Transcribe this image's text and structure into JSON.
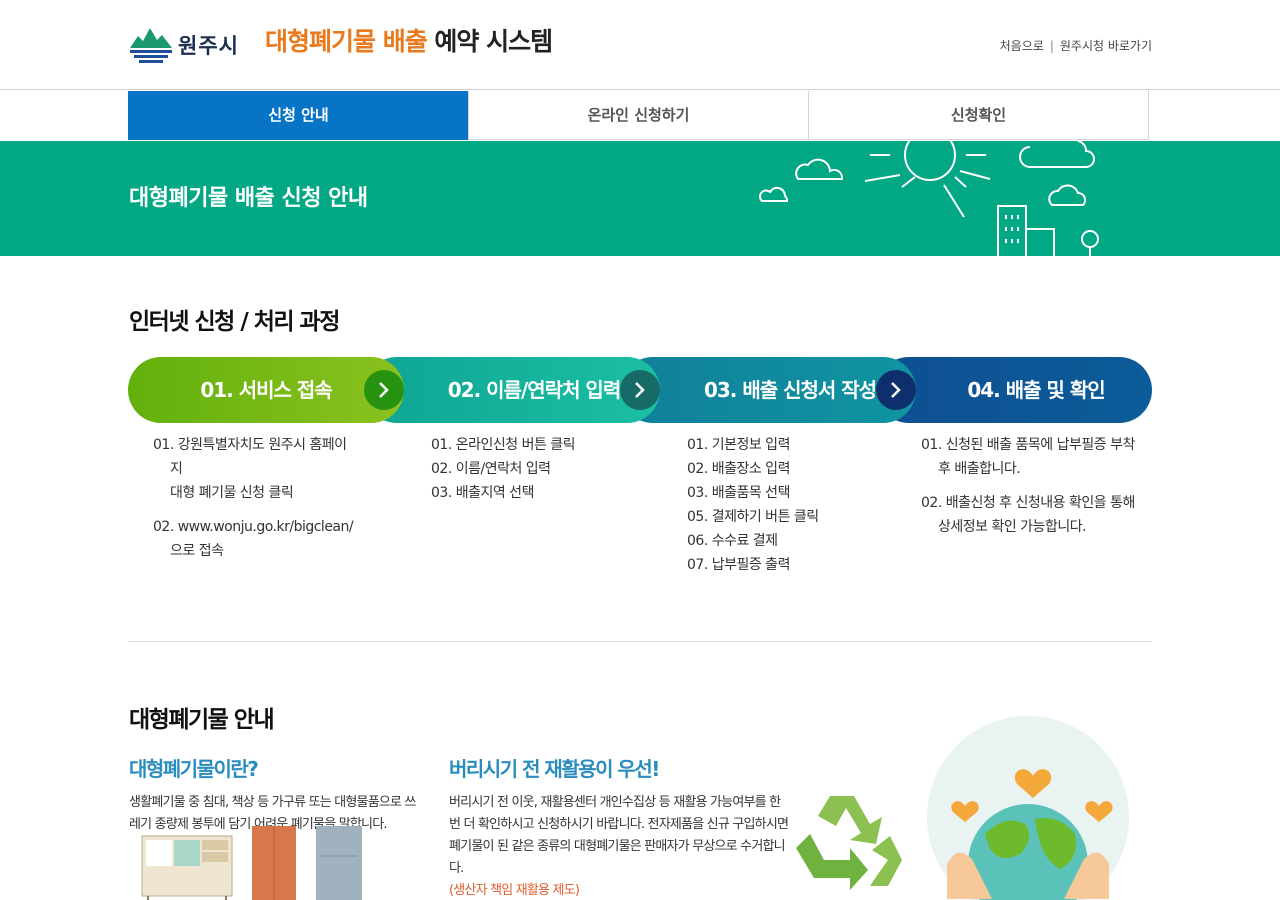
{
  "header": {
    "logo_text": "원주시",
    "title_accent": "대형폐기물 배출",
    "title_rest": " 예약 시스템",
    "util_links": [
      "처음으로",
      "원주시청 바로가기"
    ]
  },
  "tabs": [
    "신청 안내",
    "온라인 신청하기",
    "신청확인"
  ],
  "banner": {
    "title": "대형폐기물 배출 신청 안내"
  },
  "process": {
    "title": "인터넷 신청 / 처리 과정",
    "steps": [
      "01. 서비스 접속",
      "02. 이름/연락처 입력",
      "03. 배출 신청서 작성",
      "04. 배출 및 확인"
    ],
    "step1_items": [
      "01. 강원특별자치도 원주시 홈페이지\n대형 폐기물 신청 클릭",
      "02. www.wonju.go.kr/bigclean/으로 접속"
    ],
    "step2_items": [
      "01. 온라인신청 버튼 클릭",
      "02. 이름/연락처 입력",
      "03. 배출지역 선택"
    ],
    "step3_items": [
      "01. 기본정보 입력",
      "02. 배출장소 입력",
      "03. 배출품목 선택",
      "05. 결제하기 버튼 클릭",
      "06. 수수료 결제",
      "07. 납부필증 출력"
    ],
    "step4_items": [
      "01. 신청된 배출 품목에 납부필증 부착 후 배출합니다.",
      "02. 배출신청 후 신청내용 확인을 통해 상세정보 확인 가능합니다."
    ]
  },
  "guide": {
    "title": "대형폐기물 안내",
    "what_title": "대형폐기물이란?",
    "what_text": "생활폐기물 중 침대, 책상 등 가구류 또는 대형물품으로 쓰레기 종량제 봉투에 담기 어려운 폐기물을 말합니다.",
    "reuse_title": "버리시기 전 재활용이 우선!",
    "reuse_text": "버리시기 전 이웃, 재활용센터 개인수집상 등 재활용 가능여부를 한번 더 확인하시고 신청하시기 바랍니다. 전자제품을 신규 구입하시면 폐기물이 된 같은 종류의 대형폐기물은 판매자가 무상으로 수거합니다.",
    "reuse_note": "(생산자 책임 재활용 제도)"
  },
  "colors": {
    "accent_orange": "#e8791c",
    "tab_active": "#0874c5",
    "banner_green": "#02a883",
    "sub_title_blue": "#2b8dbe"
  }
}
